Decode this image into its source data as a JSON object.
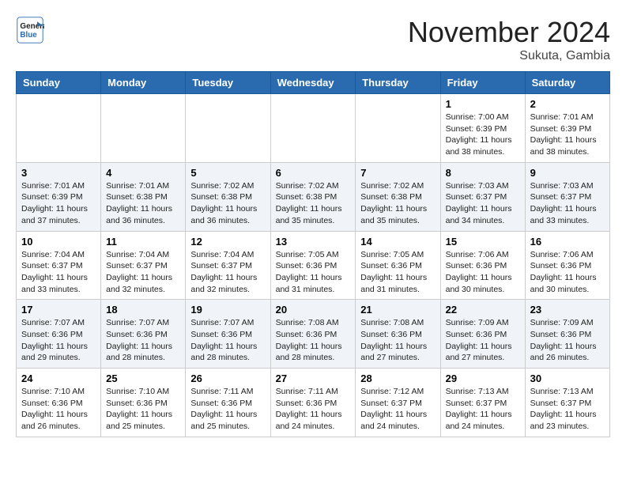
{
  "header": {
    "logo_general": "General",
    "logo_blue": "Blue",
    "month": "November 2024",
    "location": "Sukuta, Gambia"
  },
  "weekdays": [
    "Sunday",
    "Monday",
    "Tuesday",
    "Wednesday",
    "Thursday",
    "Friday",
    "Saturday"
  ],
  "weeks": [
    [
      {
        "day": "",
        "info": ""
      },
      {
        "day": "",
        "info": ""
      },
      {
        "day": "",
        "info": ""
      },
      {
        "day": "",
        "info": ""
      },
      {
        "day": "",
        "info": ""
      },
      {
        "day": "1",
        "info": "Sunrise: 7:00 AM\nSunset: 6:39 PM\nDaylight: 11 hours and 38 minutes."
      },
      {
        "day": "2",
        "info": "Sunrise: 7:01 AM\nSunset: 6:39 PM\nDaylight: 11 hours and 38 minutes."
      }
    ],
    [
      {
        "day": "3",
        "info": "Sunrise: 7:01 AM\nSunset: 6:39 PM\nDaylight: 11 hours and 37 minutes."
      },
      {
        "day": "4",
        "info": "Sunrise: 7:01 AM\nSunset: 6:38 PM\nDaylight: 11 hours and 36 minutes."
      },
      {
        "day": "5",
        "info": "Sunrise: 7:02 AM\nSunset: 6:38 PM\nDaylight: 11 hours and 36 minutes."
      },
      {
        "day": "6",
        "info": "Sunrise: 7:02 AM\nSunset: 6:38 PM\nDaylight: 11 hours and 35 minutes."
      },
      {
        "day": "7",
        "info": "Sunrise: 7:02 AM\nSunset: 6:38 PM\nDaylight: 11 hours and 35 minutes."
      },
      {
        "day": "8",
        "info": "Sunrise: 7:03 AM\nSunset: 6:37 PM\nDaylight: 11 hours and 34 minutes."
      },
      {
        "day": "9",
        "info": "Sunrise: 7:03 AM\nSunset: 6:37 PM\nDaylight: 11 hours and 33 minutes."
      }
    ],
    [
      {
        "day": "10",
        "info": "Sunrise: 7:04 AM\nSunset: 6:37 PM\nDaylight: 11 hours and 33 minutes."
      },
      {
        "day": "11",
        "info": "Sunrise: 7:04 AM\nSunset: 6:37 PM\nDaylight: 11 hours and 32 minutes."
      },
      {
        "day": "12",
        "info": "Sunrise: 7:04 AM\nSunset: 6:37 PM\nDaylight: 11 hours and 32 minutes."
      },
      {
        "day": "13",
        "info": "Sunrise: 7:05 AM\nSunset: 6:36 PM\nDaylight: 11 hours and 31 minutes."
      },
      {
        "day": "14",
        "info": "Sunrise: 7:05 AM\nSunset: 6:36 PM\nDaylight: 11 hours and 31 minutes."
      },
      {
        "day": "15",
        "info": "Sunrise: 7:06 AM\nSunset: 6:36 PM\nDaylight: 11 hours and 30 minutes."
      },
      {
        "day": "16",
        "info": "Sunrise: 7:06 AM\nSunset: 6:36 PM\nDaylight: 11 hours and 30 minutes."
      }
    ],
    [
      {
        "day": "17",
        "info": "Sunrise: 7:07 AM\nSunset: 6:36 PM\nDaylight: 11 hours and 29 minutes."
      },
      {
        "day": "18",
        "info": "Sunrise: 7:07 AM\nSunset: 6:36 PM\nDaylight: 11 hours and 28 minutes."
      },
      {
        "day": "19",
        "info": "Sunrise: 7:07 AM\nSunset: 6:36 PM\nDaylight: 11 hours and 28 minutes."
      },
      {
        "day": "20",
        "info": "Sunrise: 7:08 AM\nSunset: 6:36 PM\nDaylight: 11 hours and 28 minutes."
      },
      {
        "day": "21",
        "info": "Sunrise: 7:08 AM\nSunset: 6:36 PM\nDaylight: 11 hours and 27 minutes."
      },
      {
        "day": "22",
        "info": "Sunrise: 7:09 AM\nSunset: 6:36 PM\nDaylight: 11 hours and 27 minutes."
      },
      {
        "day": "23",
        "info": "Sunrise: 7:09 AM\nSunset: 6:36 PM\nDaylight: 11 hours and 26 minutes."
      }
    ],
    [
      {
        "day": "24",
        "info": "Sunrise: 7:10 AM\nSunset: 6:36 PM\nDaylight: 11 hours and 26 minutes."
      },
      {
        "day": "25",
        "info": "Sunrise: 7:10 AM\nSunset: 6:36 PM\nDaylight: 11 hours and 25 minutes."
      },
      {
        "day": "26",
        "info": "Sunrise: 7:11 AM\nSunset: 6:36 PM\nDaylight: 11 hours and 25 minutes."
      },
      {
        "day": "27",
        "info": "Sunrise: 7:11 AM\nSunset: 6:36 PM\nDaylight: 11 hours and 24 minutes."
      },
      {
        "day": "28",
        "info": "Sunrise: 7:12 AM\nSunset: 6:37 PM\nDaylight: 11 hours and 24 minutes."
      },
      {
        "day": "29",
        "info": "Sunrise: 7:13 AM\nSunset: 6:37 PM\nDaylight: 11 hours and 24 minutes."
      },
      {
        "day": "30",
        "info": "Sunrise: 7:13 AM\nSunset: 6:37 PM\nDaylight: 11 hours and 23 minutes."
      }
    ]
  ]
}
